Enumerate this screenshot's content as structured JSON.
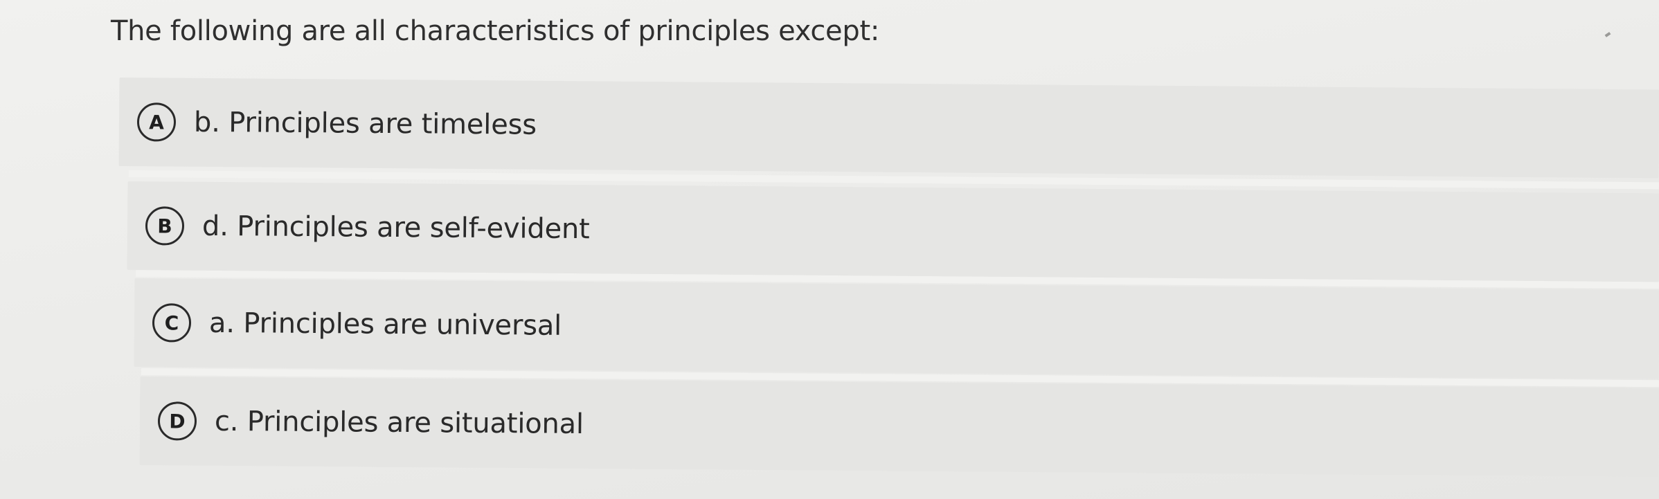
{
  "question": {
    "text": "The following are all characteristics of principles except:"
  },
  "options": [
    {
      "letter": "A",
      "text": "b. Principles are timeless"
    },
    {
      "letter": "B",
      "text": "d. Principles are self-evident"
    },
    {
      "letter": "C",
      "text": "a. Principles are universal"
    },
    {
      "letter": "D",
      "text": "c. Principles are situational"
    }
  ]
}
